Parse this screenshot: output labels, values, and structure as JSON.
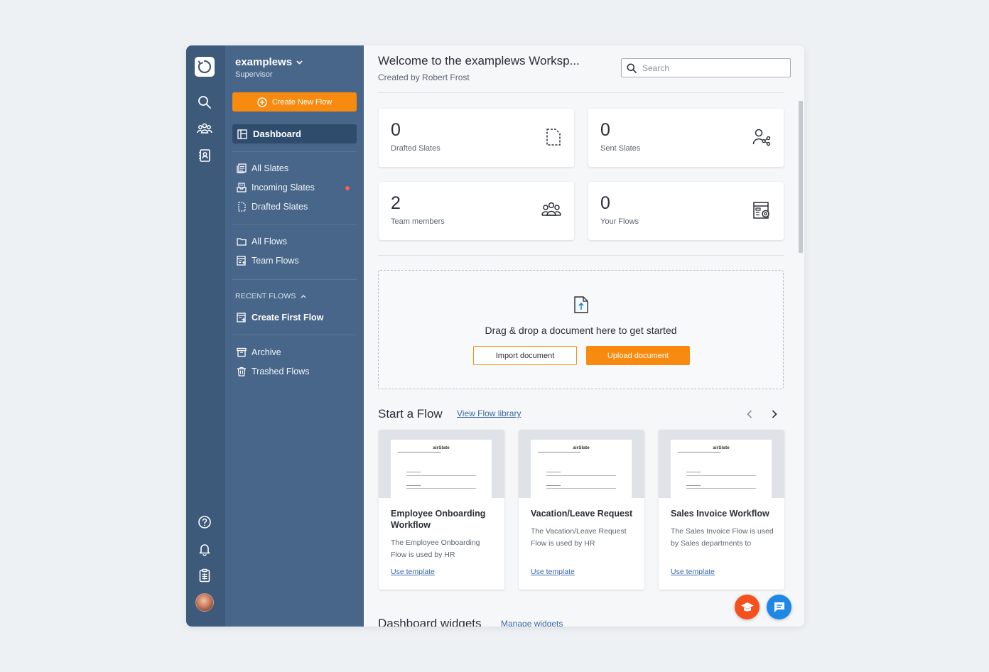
{
  "workspace": {
    "name": "examplews",
    "role": "Supervisor"
  },
  "sidebar": {
    "create_label": "Create New Flow",
    "dashboard_label": "Dashboard",
    "slates": [
      {
        "label": "All Slates"
      },
      {
        "label": "Incoming Slates"
      },
      {
        "label": "Drafted Slates"
      }
    ],
    "flows": [
      {
        "label": "All Flows"
      },
      {
        "label": "Team Flows"
      }
    ],
    "recent_label": "RECENT FLOWS",
    "recent_item": "Create First Flow",
    "archive_label": "Archive",
    "trash_label": "Trashed Flows"
  },
  "header": {
    "title": "Welcome to the examplews Worksp...",
    "subtitle": "Created by Robert Frost",
    "search_placeholder": "Search"
  },
  "stats": [
    {
      "value": "0",
      "label": "Drafted Slates",
      "icon": "drafted-slate-icon"
    },
    {
      "value": "0",
      "label": "Sent Slates",
      "icon": "sent-share-icon"
    },
    {
      "value": "2",
      "label": "Team members",
      "icon": "team-members-icon"
    },
    {
      "value": "0",
      "label": "Your Flows",
      "icon": "flows-gear-icon"
    }
  ],
  "dropzone": {
    "text": "Drag & drop a document here to get started",
    "import_label": "Import document",
    "upload_label": "Upload document"
  },
  "start_flow": {
    "title": "Start a Flow",
    "library_link": "View Flow library",
    "templates": [
      {
        "title": "Employee Onboarding Workflow",
        "description": "The Employee Onboarding Flow is used by HR",
        "cta": "Use template",
        "brand": "airSlate"
      },
      {
        "title": "Vacation/Leave Request",
        "description": "The Vacation/Leave Request Flow is used by HR",
        "cta": "Use template",
        "brand": "airSlate"
      },
      {
        "title": "Sales Invoice Workflow",
        "description": "The Sales Invoice Flow is used by Sales departments to",
        "cta": "Use template",
        "brand": "airSlate"
      }
    ]
  },
  "widgets": {
    "title": "Dashboard widgets",
    "manage_link": "Manage widgets"
  },
  "colors": {
    "rail": "#3d5a7a",
    "sidebar": "#476689",
    "accent": "#f88b0f",
    "link": "#3a68a8",
    "academy_fab": "#f4511e",
    "chat_fab": "#1e88e5"
  }
}
